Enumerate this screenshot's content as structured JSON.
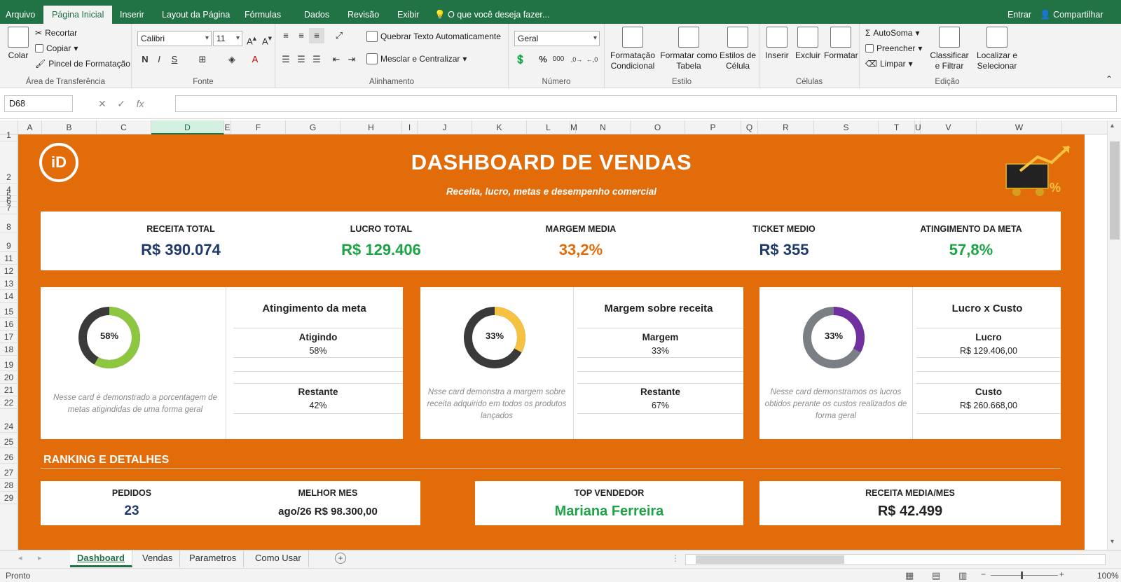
{
  "ribbon_tabs": [
    "Arquivo",
    "Página Inicial",
    "Inserir",
    "Layout da Página",
    "Fórmulas",
    "Dados",
    "Revisão",
    "Exibir"
  ],
  "tell_me": "O que você deseja fazer...",
  "sign_in": "Entrar",
  "share": "Compartilhar",
  "clipboard": {
    "paste": "Colar",
    "cut": "Recortar",
    "copy": "Copiar",
    "format_painter": "Pincel de Formatação",
    "label": "Área de Transferência"
  },
  "font": {
    "name": "Calibri",
    "size": "11",
    "bold": "N",
    "italic": "I",
    "underline": "S",
    "label": "Fonte"
  },
  "alignment": {
    "wrap": "Quebrar Texto Automaticamente",
    "merge": "Mesclar e Centralizar",
    "label": "Alinhamento"
  },
  "number": {
    "format": "Geral",
    "percent": "%",
    "thousands": "000",
    "label": "Número"
  },
  "styles": {
    "conditional": "Formatação Condicional",
    "as_table": "Formatar como Tabela",
    "cell_styles": "Estilos de Célula",
    "label": "Estilo"
  },
  "cells": {
    "insert": "Inserir",
    "delete": "Excluir",
    "format": "Formatar",
    "label": "Células"
  },
  "editing": {
    "autosum": "AutoSoma",
    "fill": "Preencher",
    "clear": "Limpar",
    "sort": "Classificar e Filtrar",
    "find": "Localizar e Selecionar",
    "label": "Edição"
  },
  "name_box": "D68",
  "fx": "fx",
  "columns": [
    "A",
    "B",
    "C",
    "D",
    "E",
    "F",
    "G",
    "H",
    "I",
    "J",
    "K",
    "L",
    "M",
    "N",
    "O",
    "P",
    "Q",
    "R",
    "S",
    "T",
    "U",
    "V",
    "W"
  ],
  "rows": [
    "1",
    "2",
    "4",
    "5",
    "6",
    "7",
    "8",
    "9",
    "11",
    "12",
    "13",
    "14",
    "15",
    "16",
    "17",
    "18",
    "19",
    "20",
    "21",
    "22",
    "24",
    "25",
    "26",
    "27",
    "28",
    "29"
  ],
  "dashboard": {
    "title": "DASHBOARD DE VENDAS",
    "subtitle": "Receita, lucro, metas e desempenho comercial",
    "logo": "iD",
    "kpis": [
      {
        "label": "RECEITA TOTAL",
        "value": "R$ 390.074",
        "color": "#1f3a6b"
      },
      {
        "label": "LUCRO TOTAL",
        "value": "R$ 129.406",
        "color": "#1ea446"
      },
      {
        "label": "MARGEM MEDIA",
        "value": "33,2%",
        "color": "#e36c0a"
      },
      {
        "label": "TICKET MEDIO",
        "value": "R$ 355",
        "color": "#1f3a6b"
      },
      {
        "label": "ATINGIMENTO DA META",
        "value": "57,8%",
        "color": "#1ea446"
      }
    ],
    "cards": [
      {
        "title": "Atingimento da meta",
        "donut_label": "58%",
        "fraction": 0.58,
        "fg": "#8dc63f",
        "bg": "#3a3a3a",
        "desc": "Nesse card é demonstrado a porcentagem de metas atigindidas de uma forma geral",
        "stat1_label": "Atigindo",
        "stat1_value": "58%",
        "stat2_label": "Restante",
        "stat2_value": "42%"
      },
      {
        "title": "Margem sobre receita",
        "donut_label": "33%",
        "fraction": 0.33,
        "fg": "#f5c242",
        "bg": "#3a3a3a",
        "desc": "Nsse card demonstra a margem sobre receita adquirido em todos os produtos lançados",
        "stat1_label": "Margem",
        "stat1_value": "33%",
        "stat2_label": "Restante",
        "stat2_value": "67%"
      },
      {
        "title": "Lucro x Custo",
        "donut_label": "33%",
        "fraction": 0.33,
        "fg": "#7030a0",
        "bg": "#7a7f86",
        "desc": "Nesse card demonstramos os lucros obtidos perante os custos realizados de forma geral",
        "stat1_label": "Lucro",
        "stat1_value": "R$ 129.406,00",
        "stat2_label": "Custo",
        "stat2_value": "R$ 260.668,00"
      }
    ],
    "section_title": "RANKING E DETALHES",
    "details": {
      "orders_label": "PEDIDOS",
      "orders_value": "23",
      "best_month_label": "MELHOR MES",
      "best_month_value": "ago/26 R$ 98.300,00",
      "top_seller_label": "TOP VENDEDOR",
      "top_seller_value": "Mariana Ferreira",
      "avg_rev_label": "RECEITA MEDIA/MES",
      "avg_rev_value": "R$ 42.499"
    }
  },
  "sheet_tabs": [
    "Dashboard",
    "Vendas",
    "Parametros",
    "Como Usar"
  ],
  "status": "Pronto",
  "zoom": "100%"
}
